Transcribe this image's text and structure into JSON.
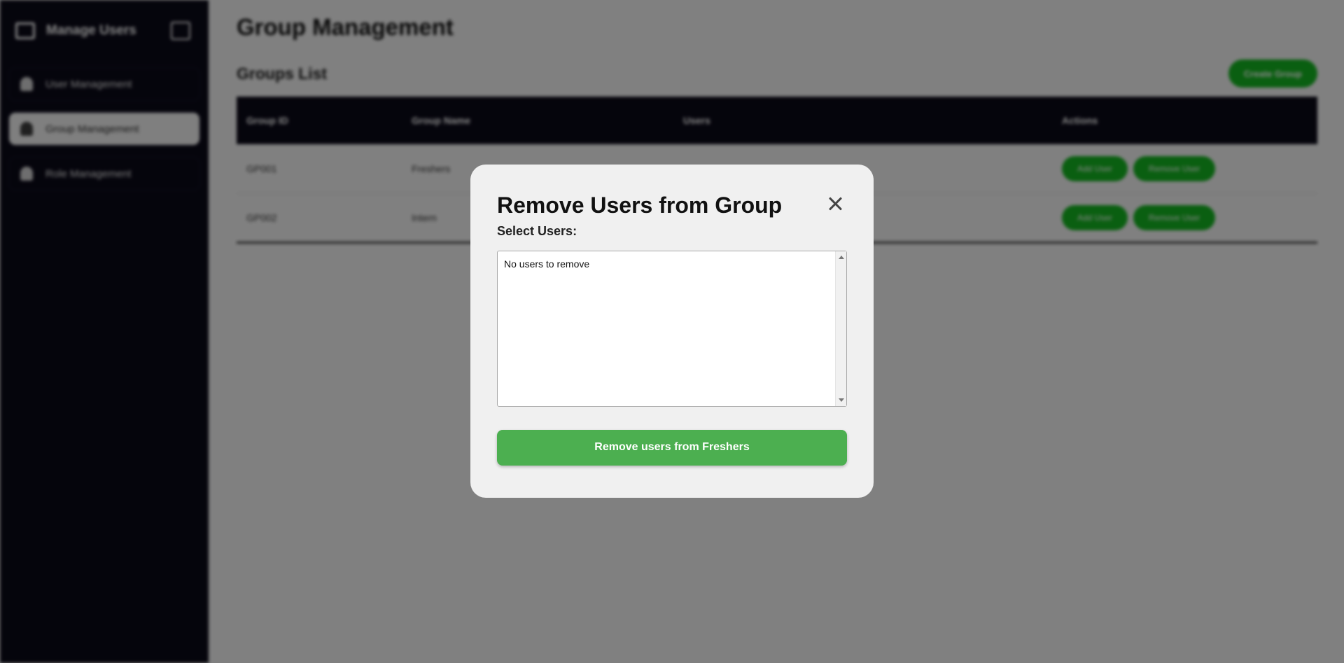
{
  "sidebar": {
    "brand_title": "Manage Users",
    "items": [
      {
        "label": "User Management"
      },
      {
        "label": "Group Management"
      },
      {
        "label": "Role Management"
      }
    ]
  },
  "main": {
    "page_title": "Group Management",
    "list_title": "Groups List",
    "create_button": "Create Group",
    "table": {
      "headers": [
        "Group ID",
        "Group Name",
        "Users",
        "Actions"
      ],
      "rows": [
        {
          "id": "GP001",
          "name": "Freshers",
          "users": "",
          "add": "Add User",
          "remove": "Remove User"
        },
        {
          "id": "GP002",
          "name": "Intern",
          "users": "",
          "add": "Add User",
          "remove": "Remove User"
        }
      ]
    }
  },
  "modal": {
    "title": "Remove Users from Group",
    "select_label": "Select Users:",
    "empty_text": "No users to remove",
    "submit_label": "Remove users from Freshers"
  },
  "colors": {
    "sidebar_bg": "#0b0a18",
    "accent_green": "#4caf50",
    "button_green": "#14b320"
  }
}
